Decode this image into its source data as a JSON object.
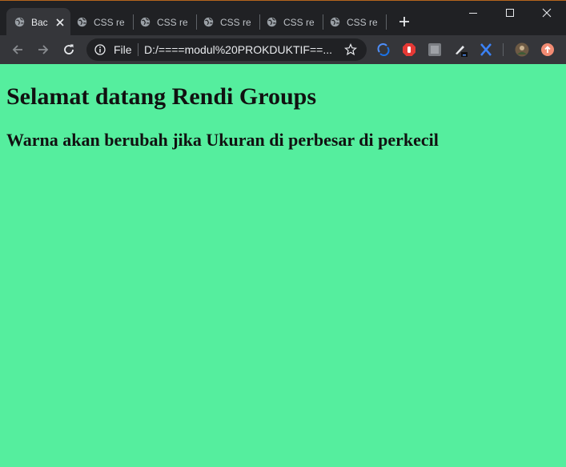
{
  "browser": {
    "tabs": [
      {
        "title": "Bac",
        "active": true
      },
      {
        "title": "CSS res",
        "active": false
      },
      {
        "title": "CSS res",
        "active": false
      },
      {
        "title": "CSS res",
        "active": false
      },
      {
        "title": "CSS res",
        "active": false
      },
      {
        "title": "CSS res",
        "active": false
      }
    ],
    "omnibox": {
      "scheme_label": "File",
      "url": "D:/====modul%20PROKDUKTIF==..."
    },
    "colors": {
      "frame": "#202124",
      "toolbar": "#35363a",
      "text": "#e8eaed"
    }
  },
  "page": {
    "background": "#55ee9e",
    "heading": "Selamat datang Rendi Groups",
    "subheading": "Warna akan berubah jika Ukuran di perbesar di perkecil"
  }
}
